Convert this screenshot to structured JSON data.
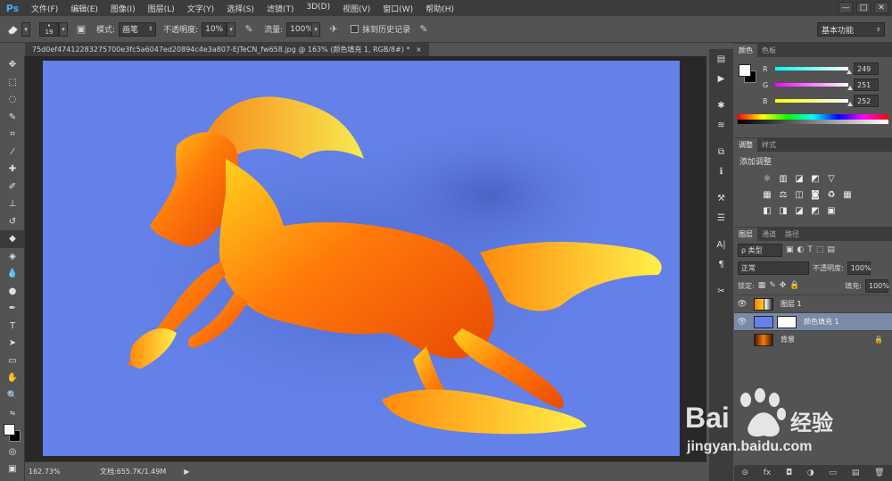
{
  "app": {
    "logo": "Ps"
  },
  "menu": [
    "文件(F)",
    "编辑(E)",
    "图像(I)",
    "图层(L)",
    "文字(Y)",
    "选择(S)",
    "滤镜(T)",
    "3D(D)",
    "视图(V)",
    "窗口(W)",
    "帮助(H)"
  ],
  "window_buttons": [
    "—",
    "□",
    "✕"
  ],
  "options": {
    "brush_size": "19",
    "mode_label": "模式:",
    "mode_value": "画笔",
    "opacity_label": "不透明度:",
    "opacity_value": "10%",
    "flow_label": "流量:",
    "flow_value": "100%",
    "history_label": "抹到历史记录",
    "workspace": "基本功能"
  },
  "document": {
    "tab_title": "75d0ef47412283275700e3fc5a6047ed20894c4e3a807-EJTeCN_fw658.jpg @ 163% (颜色填充 1, RGB/8#) *",
    "close": "×",
    "canvas_color": "#6381e8"
  },
  "status": {
    "zoom": "162.73%",
    "doc": "文档:655.7K/1.49M"
  },
  "color_panel": {
    "tabs": [
      "颜色",
      "色板"
    ],
    "channels": [
      {
        "label": "R",
        "value": "249",
        "gradient": "linear-gradient(90deg,#00fcfc,#f9fcfc)",
        "fraction": 0.976
      },
      {
        "label": "G",
        "value": "251",
        "gradient": "linear-gradient(90deg,#f900fc,#f9fcfc)",
        "fraction": 0.984
      },
      {
        "label": "B",
        "value": "252",
        "gradient": "linear-gradient(90deg,#f9fc00,#f9fcfc)",
        "fraction": 0.988
      }
    ],
    "fg_color": "#f9fbfc",
    "bg_color": "#000000"
  },
  "adjust_panel": {
    "tabs": [
      "调整",
      "样式"
    ],
    "title": "添加调整",
    "row1": [
      "☼",
      "▥",
      "◪",
      "◩",
      "▽"
    ],
    "row2": [
      "▦",
      "⚖",
      "◫",
      "◙",
      "♻",
      "▦"
    ],
    "row3": [
      "◧",
      "◨",
      "◪",
      "◩",
      "▣"
    ]
  },
  "layers_panel": {
    "tabs": [
      "图层",
      "通道",
      "路径"
    ],
    "filter": "ρ 类型",
    "blend": "正常",
    "opacity_label": "不透明度:",
    "opacity": "100%",
    "lock_label": "锁定:",
    "fill_label": "填充:",
    "fill": "100%",
    "layers": [
      {
        "name": "图层 1",
        "visible": "👁",
        "lock": ""
      },
      {
        "name": "颜色填充 1",
        "visible": "👁",
        "lock": ""
      },
      {
        "name": "背景",
        "visible": "",
        "lock": "🔒"
      }
    ],
    "footer": [
      "⊝",
      "fx",
      "◘",
      "◑",
      "▭",
      "▤",
      "🗑"
    ]
  },
  "watermark": {
    "brand": "Bai",
    "brand2": "经验",
    "url": "jingyan.baidu.com"
  }
}
